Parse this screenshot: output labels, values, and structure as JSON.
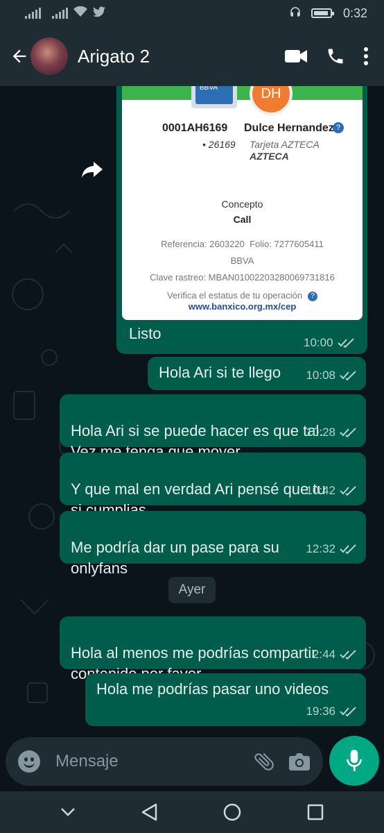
{
  "status_bar": {
    "time": "0:32",
    "icons": [
      "signal-icon",
      "signal-icon",
      "wifi-icon",
      "twitter-icon",
      "headset-icon",
      "battery-icon"
    ]
  },
  "header": {
    "contact_name": "Arigato 2",
    "icons": [
      "back-arrow-icon",
      "video-call-icon",
      "phone-icon",
      "more-vert-icon"
    ]
  },
  "receipt": {
    "bank_logo_text": "BBVA",
    "recipient_initials": "DH",
    "account": "0001AH6169",
    "account_last4": "• 26169",
    "recipient_name": "Dulce Hernandez",
    "card_type": "Tarjeta AZTECA",
    "bank_dest": "AZTECA",
    "concepto_label": "Concepto",
    "concepto_value": "Call",
    "referencia_folio": "Referencia: 2603220  Folio: 7277605411",
    "bank_origin": "BBVA",
    "clave_rastreo": "Clave rastreo: MBAN01002203280069731816",
    "verify_text": "Verifica el estatus de tu operación",
    "url": "www.banxico.org.mx/cep"
  },
  "messages": [
    {
      "text": "Listo",
      "time": "10:00"
    },
    {
      "text": "Hola Ari si te llego",
      "time": "10:08"
    },
    {
      "text": "Hola Ari si se puede hacer es que tal.\nVez me tenga que mover",
      "time": "10:28"
    },
    {
      "text": "Y que mal en verdad Ari pensé que tu\nsi cumplias",
      "time": "10:42"
    },
    {
      "text": "Me podría dar un pase para su\nonlyfans",
      "time": "12:32"
    },
    {
      "text": "Hola al menos me podrías compartir\ncontenido por favor",
      "time": "2:44"
    },
    {
      "text": "Hola me podrías pasar uno videos",
      "time": "19:36"
    }
  ],
  "day_separator": "Ayer",
  "input": {
    "placeholder": "Mensaje"
  },
  "colors": {
    "outgoing_bubble": "#005c4b",
    "accent": "#00a884",
    "background": "#0b141a",
    "bar": "#1f2c33"
  }
}
